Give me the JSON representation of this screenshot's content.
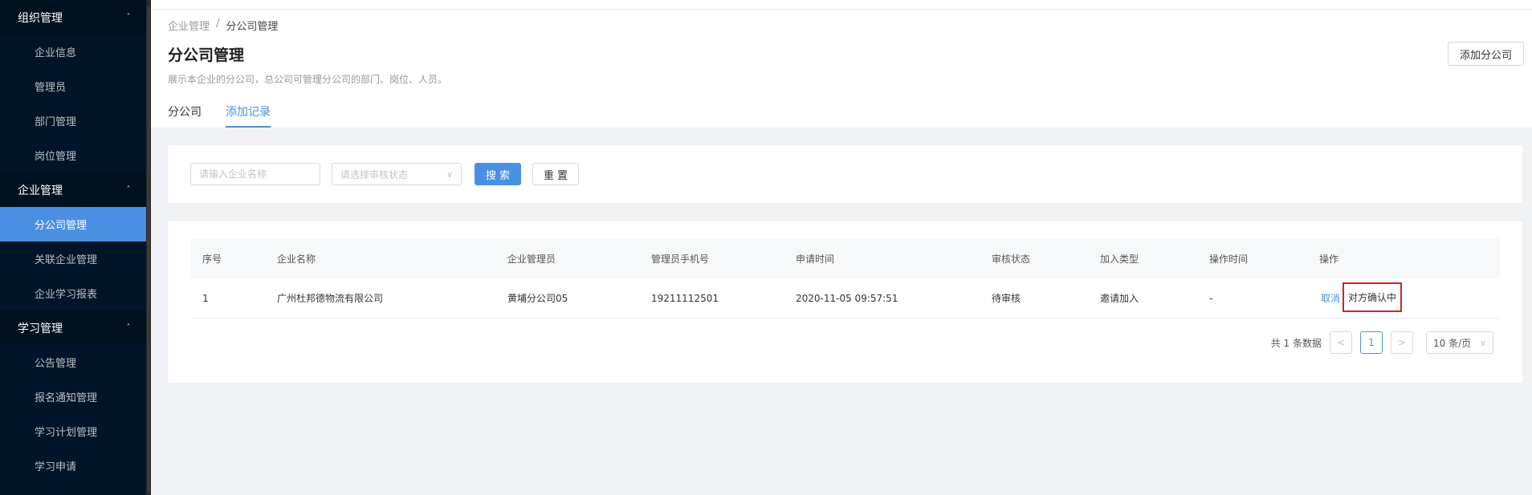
{
  "sidebar": {
    "groups": [
      {
        "title": "组织管理",
        "items": [
          "企业信息",
          "管理员",
          "部门管理",
          "岗位管理"
        ]
      },
      {
        "title": "企业管理",
        "items": [
          "分公司管理",
          "关联企业管理",
          "企业学习报表"
        ]
      },
      {
        "title": "学习管理",
        "items": [
          "公告管理",
          "报名通知管理",
          "学习计划管理",
          "学习申请"
        ]
      }
    ],
    "active_item": "分公司管理"
  },
  "breadcrumb": {
    "parent": "企业管理",
    "separator": "/",
    "current": "分公司管理"
  },
  "page": {
    "title": "分公司管理",
    "description": "展示本企业的分公司，总公司可管理分公司的部门、岗位、人员。",
    "add_button": "添加分公司"
  },
  "tabs": [
    {
      "label": "分公司",
      "active": false
    },
    {
      "label": "添加记录",
      "active": true
    }
  ],
  "search": {
    "name_placeholder": "请输入企业名称",
    "status_placeholder": "请选择审核状态",
    "search_button": "搜 索",
    "reset_button": "重 置"
  },
  "table": {
    "columns": [
      "序号",
      "企业名称",
      "企业管理员",
      "管理员手机号",
      "申请时间",
      "审核状态",
      "加入类型",
      "操作时间",
      "操作"
    ],
    "rows": [
      {
        "index": "1",
        "company": "广州杜邦德物流有限公司",
        "admin": "黄埔分公司05",
        "phone": "19211112501",
        "apply_time": "2020-11-05 09:57:51",
        "status": "待审核",
        "join_type": "邀请加入",
        "op_time": "-",
        "op_cancel": "取消",
        "op_status": "对方确认中"
      }
    ]
  },
  "pagination": {
    "total_text": "共 1 条数据",
    "prev": "<",
    "current_page": "1",
    "next": ">",
    "page_size": "10 条/页"
  },
  "colors": {
    "primary": "#4a90e2",
    "sidebar_bg": "#001529",
    "highlight_border": "#d92020"
  }
}
